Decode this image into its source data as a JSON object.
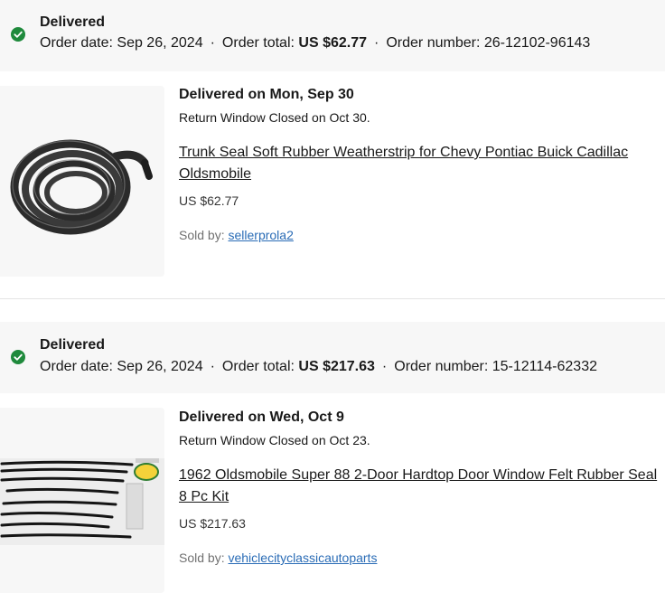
{
  "orders": [
    {
      "status": "Delivered",
      "order_date_label": "Order date:",
      "order_date": "Sep 26, 2024",
      "order_total_label": "Order total:",
      "order_total": "US $62.77",
      "order_number_label": "Order number:",
      "order_number": "26-12102-96143",
      "delivered_on": "Delivered on Mon, Sep 30",
      "return_window": "Return Window Closed on Oct 30.",
      "item_title": "Trunk Seal Soft Rubber Weatherstrip for Chevy Pontiac Buick Cadillac Oldsmobile",
      "item_price": "US $62.77",
      "sold_by_label": "Sold by:",
      "seller": "sellerprola2"
    },
    {
      "status": "Delivered",
      "order_date_label": "Order date:",
      "order_date": "Sep 26, 2024",
      "order_total_label": "Order total:",
      "order_total": "US $217.63",
      "order_number_label": "Order number:",
      "order_number": "15-12114-62332",
      "delivered_on": "Delivered on Wed, Oct 9",
      "return_window": "Return Window Closed on Oct 23.",
      "item_title": "1962 Oldsmobile Super 88 2-Door Hardtop Door Window Felt Rubber Seal 8 Pc Kit",
      "item_price": "US $217.63",
      "sold_by_label": "Sold by:",
      "seller": "vehiclecityclassicautoparts"
    }
  ],
  "separator": "·",
  "colors": {
    "delivered_green": "#1f8a3c",
    "header_bg": "#f7f7f7",
    "link_blue": "#2a6cb6"
  },
  "icons": {
    "status": "check-circle-icon",
    "item_1": "rubber-seal-coil-image",
    "item_2": "felt-seal-kit-image"
  }
}
